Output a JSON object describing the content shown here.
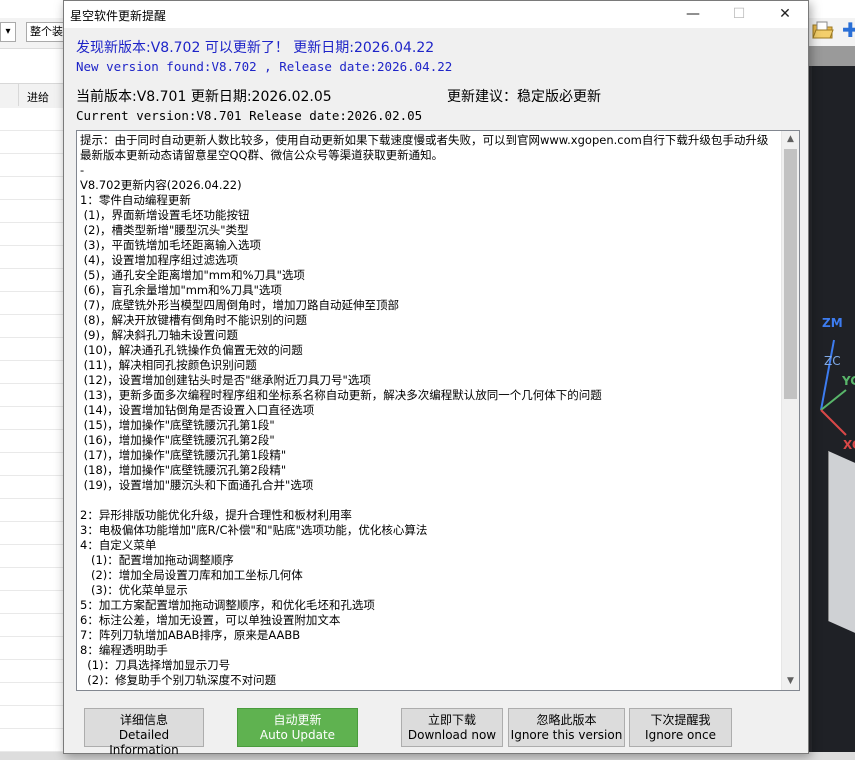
{
  "background_app": {
    "dropdown_visible_text": "整个装",
    "grid_column_header": "进给",
    "axis_labels": {
      "zm": "ZM",
      "zc": "ZC",
      "y": "YC",
      "x": "XC"
    }
  },
  "dialog": {
    "title": "星空软件更新提醒",
    "window_controls": {
      "minimize": "—",
      "maximize": "☐",
      "close": "✕"
    },
    "new_version_line_cn": "发现新版本:V8.702 可以更新了！  更新日期:2026.04.22",
    "new_version_line_en": "New version found:V8.702 , Release date:2026.04.22",
    "current_version_line_cn": "当前版本:V8.701   更新日期:2026.02.05",
    "update_advice": "更新建议：稳定版必更新",
    "current_version_line_en": "Current version:V8.701    Release date:2026.02.05",
    "changelog_lines": [
      "提示：由于同时自动更新人数比较多，使用自动更新如果下载速度慢或者失败，可以到官网www.xgopen.com自行下载升级包手动升级",
      "最新版本更新动态请留意星空QQ群、微信公众号等渠道获取更新通知。",
      "-",
      "V8.702更新内容(2026.04.22)",
      "1：零件自动编程更新",
      " (1)，界面新增设置毛坯功能按钮",
      " (2)，槽类型新增\"腰型沉头\"类型",
      " (3)，平面铣增加毛坯距离输入选项",
      " (4)，设置增加程序组过滤选项",
      " (5)，通孔安全距离增加\"mm和%刀具\"选项",
      " (6)，盲孔余量增加\"mm和%刀具\"选项",
      " (7)，底壁铣外形当模型四周倒角时，增加刀路自动延伸至顶部",
      " (8)，解决开放键槽有倒角时不能识别的问题",
      " (9)，解决斜孔刀轴未设置问题",
      " (10)，解决通孔孔铣操作负偏置无效的问题",
      " (11)，解决相同孔按颜色识别问题",
      " (12)，设置增加创建钻头时是否\"继承附近刀具刀号\"选项",
      " (13)，更新多面多次编程时程序组和坐标系名称自动更新，解决多次编程默认放同一个几何体下的问题",
      " (14)，设置增加钻倒角是否设置入口直径选项",
      " (15)，增加操作\"底壁铣腰沉孔第1段\"",
      " (16)，增加操作\"底壁铣腰沉孔第2段\"",
      " (17)，增加操作\"底壁铣腰沉孔第1段精\"",
      " (18)，增加操作\"底壁铣腰沉孔第2段精\"",
      " (19)，设置增加\"腰沉头和下面通孔合并\"选项",
      "",
      "2：异形排版功能优化升级，提升合理性和板材利用率",
      "3：电极偏体功能增加\"底R/C补偿\"和\"贴底\"选项功能，优化核心算法",
      "4：自定义菜单",
      "   (1)：配置增加拖动调整顺序",
      "   (2)：增加全局设置刀库和加工坐标几何体",
      "   (3)：优化菜单显示",
      "5：加工方案配置增加拖动调整顺序，和优化毛坯和孔选项",
      "6：标注公差，增加无设置，可以单独设置附加文本",
      "7：阵列刀轨增加ABAB排序，原来是AABB",
      "8：编程透明助手",
      "  (1)：刀具选择增加显示刀号",
      "  (2)：修复助手个别刀轨深度不对问题"
    ],
    "buttons": {
      "details": {
        "cn": "详细信息",
        "en": "Detailed Information"
      },
      "auto_update": {
        "cn": "自动更新",
        "en": "Auto Update"
      },
      "download_now": {
        "cn": "立即下载",
        "en": "Download now"
      },
      "ignore_version": {
        "cn": "忽略此版本",
        "en": "Ignore this version"
      },
      "remind_later": {
        "cn": "下次提醒我",
        "en": "Ignore once"
      }
    },
    "colors": {
      "blue_text": "#1e24c8",
      "auto_update_green": "#5fb250"
    }
  }
}
